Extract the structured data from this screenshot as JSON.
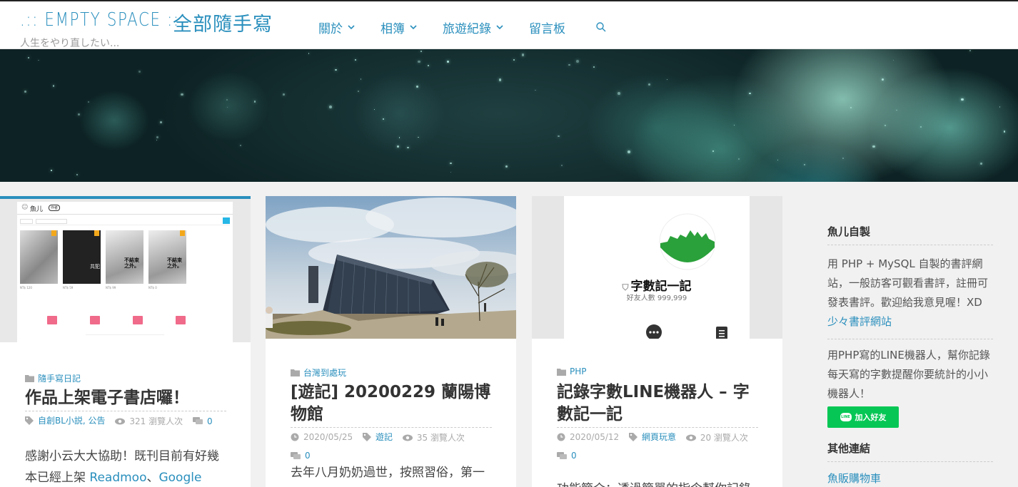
{
  "header": {
    "site_title_en": ".:: EMPTY SPACE ::.",
    "site_title_zh": "全部隨手寫",
    "tagline": "人生をやり直したい...",
    "nav": [
      {
        "label": "關於",
        "has_dropdown": true
      },
      {
        "label": "相簿",
        "has_dropdown": true
      },
      {
        "label": "旅遊紀錄",
        "has_dropdown": true
      },
      {
        "label": "留言板",
        "has_dropdown": false
      }
    ],
    "search_icon": "search-icon"
  },
  "colors": {
    "accent": "#2a8fbd",
    "line_green": "#06c755"
  },
  "posts": [
    {
      "category": "隨手寫日記",
      "title": "作品上架電子書店囉！",
      "tags": "自創BL小説, 公告",
      "views": "321 瀏覽人次",
      "comments": "0",
      "excerpt_prefix": "感謝小云大大協助！既刊目前有好幾本已經上架 ",
      "excerpt_link1": "Readmoo",
      "excerpt_sep": "、",
      "excerpt_link2": "Google Play",
      "thumb": {
        "username": "魚儿",
        "badge": "作者",
        "books": [
          {
            "cover_text": "",
            "price": "NT$ 120"
          },
          {
            "cover_text": "共犯",
            "price": "NT$ 59"
          },
          {
            "cover_text": "不結束之外。",
            "price": "NT$ 99"
          },
          {
            "cover_text": "不結束之外。",
            "price": "NT$ 0"
          }
        ]
      }
    },
    {
      "category": "台灣到處玩",
      "title": "[遊記] 20200229 蘭陽博物館",
      "date": "2020/05/25",
      "tag": "遊記",
      "views": "35 瀏覽人次",
      "comments": "0",
      "excerpt": "去年八月奶奶過世，按照習俗，第一"
    },
    {
      "category": "PHP",
      "title": "記錄字數LINE機器人 – 字數記一記",
      "date": "2020/05/12",
      "tag": "網頁玩意",
      "views": "20 瀏覽人次",
      "comments": "0",
      "excerpt": "功能簡介：透過簡單的指令幫你記錄",
      "thumb": {
        "bot_name": "字數記一記",
        "friends": "好友人數 999,999"
      }
    }
  ],
  "sidebar": {
    "widget1_title": "魚儿自製",
    "widget1_text": "用 PHP + MySQL 自製的書評網站，一般訪客可觀看書評，註冊可發表書評。歡迎給我意見喔！XD",
    "widget1_link": "少々書評網站",
    "widget2_text": "用PHP寫的LINE機器人，幫你記錄每天寫的字數提醒你要統計的小小機器人！",
    "line_badge": "LINE",
    "line_button": "加入好友",
    "widget3_title": "其他連結",
    "widget3_link": "魚販購物車"
  }
}
